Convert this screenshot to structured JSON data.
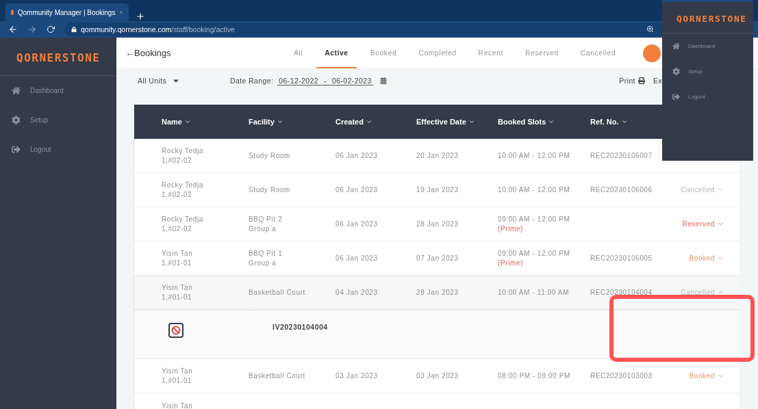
{
  "browser": {
    "tab_title": "Qommunity Manager | Bookings",
    "address_host": "qommunity.qornerstone.com",
    "address_path": "/staff/booking/active"
  },
  "sidebar": {
    "logo": "QORNERSTONE",
    "items": [
      {
        "label": "Dashboard"
      },
      {
        "label": "Setup"
      },
      {
        "label": "Logout"
      }
    ]
  },
  "header": {
    "back_title": "←Bookings",
    "tabs": [
      {
        "label": "All",
        "selected": false
      },
      {
        "label": "Active",
        "selected": true
      },
      {
        "label": "Booked",
        "selected": false
      },
      {
        "label": "Completed",
        "selected": false
      },
      {
        "label": "Recent",
        "selected": false
      },
      {
        "label": "Reserved",
        "selected": false
      },
      {
        "label": "Cancelled",
        "selected": false
      }
    ]
  },
  "filters": {
    "units": "All Units",
    "date_label": "Date Range:",
    "date_from": "06-12-2022",
    "date_sep": "-",
    "date_to": "06-02-2023",
    "print": "Print",
    "export": "Ex"
  },
  "table": {
    "columns": [
      "Name",
      "Facility",
      "Created",
      "Effective Date",
      "Booked Slots",
      "Ref. No."
    ],
    "rows": [
      {
        "name": "Rocky Tedja",
        "unit": "1,#02-02",
        "facility": "Study Room",
        "created": "06 Jan 2023",
        "effective": "20 Jan 2023",
        "slot": "10:00 AM - 12:00 PM",
        "ref": "REC20230106007"
      },
      {
        "name": "Rocky Tedja",
        "unit": "1,#02-02",
        "facility": "Study Room",
        "created": "06 Jan 2023",
        "effective": "19 Jan 2023",
        "slot": "10:00 AM - 12:00 PM",
        "ref": "REC20230106006",
        "status": "Cancelled",
        "color": "#b5b5b5",
        "expanded": false
      },
      {
        "name": "Rocky Tedja",
        "unit": "1,#02-02",
        "facility": "BBQ Pit 2",
        "facility_sub": "Group a",
        "created": "06 Jan 2023",
        "effective": "28 Jan 2023",
        "slot": "09:00 AM - 12:00 PM",
        "slot_note": "(Prime)",
        "status": "Reserved",
        "color": "#e0605a",
        "expanded": false
      },
      {
        "name": "Yisin Tan",
        "unit": "1,#01-01",
        "facility": "BBQ Pit 1",
        "facility_sub": "Group a",
        "created": "06 Jan 2023",
        "effective": "07 Jan 2023",
        "slot": "09:00 AM - 12:00 PM",
        "slot_note": "(Prime)",
        "ref": "REC20230106005",
        "status": "Booked",
        "color": "#f08a5d",
        "expanded": false
      },
      {
        "name": "Yisin Tan",
        "unit": "1,#01-01",
        "facility": "Basketball Court",
        "created": "04 Jan 2023",
        "effective": "28 Jan 2023",
        "slot": "10:00 AM - 11:00 AM",
        "ref": "REC20230104004",
        "status": "Cancelled",
        "color": "#b5b5b5",
        "expanded": true,
        "detail": "IV20230104004"
      },
      {
        "name": "Yisin Tan",
        "unit": "1,#01-01",
        "facility": "Basketball Court",
        "created": "03 Jan 2023",
        "effective": "03 Jan 2023",
        "slot": "08:00 PM - 09:00 PM",
        "ref": "REC20230103003",
        "status": "Booked",
        "color": "#f08a5d",
        "expanded": false
      },
      {
        "name": "Yisin Tan"
      }
    ]
  },
  "overlay_menu": {
    "logo": "QORNERSTONE",
    "items": [
      {
        "label": "Dashboard"
      },
      {
        "label": "Setup"
      },
      {
        "label": "Logout"
      }
    ]
  }
}
